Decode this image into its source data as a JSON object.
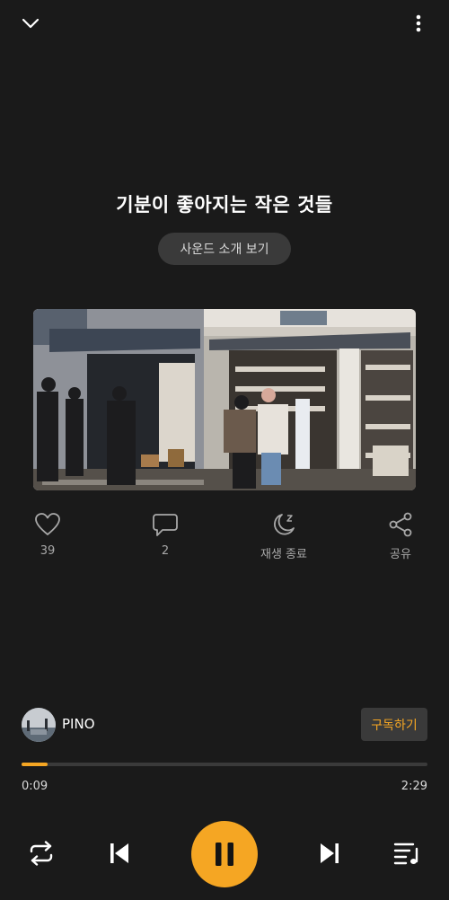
{
  "header": {
    "collapse_icon": "chevron-down-icon",
    "more_icon": "more-vertical-icon"
  },
  "episode": {
    "title": "기분이 좋아지는 작은 것들",
    "intro_button": "사운드 소개 보기"
  },
  "actions": {
    "like": {
      "icon": "heart-icon",
      "label": "39"
    },
    "comment": {
      "icon": "comment-icon",
      "label": "2"
    },
    "sleep_timer": {
      "icon": "moon-icon",
      "label": "재생 종료"
    },
    "share": {
      "icon": "share-icon",
      "label": "공유"
    }
  },
  "author": {
    "name": "PINO",
    "subscribe_label": "구독하기"
  },
  "progress": {
    "current": "0:09",
    "total": "2:29",
    "fraction": 0.065
  },
  "controls": {
    "repeat_icon": "repeat-icon",
    "previous_icon": "skip-previous-icon",
    "play_pause_icon": "pause-icon",
    "next_icon": "skip-next-icon",
    "playlist_icon": "playlist-icon"
  },
  "colors": {
    "background": "#1a1a1a",
    "accent": "#f5a623",
    "pill": "#3a3a3a"
  }
}
